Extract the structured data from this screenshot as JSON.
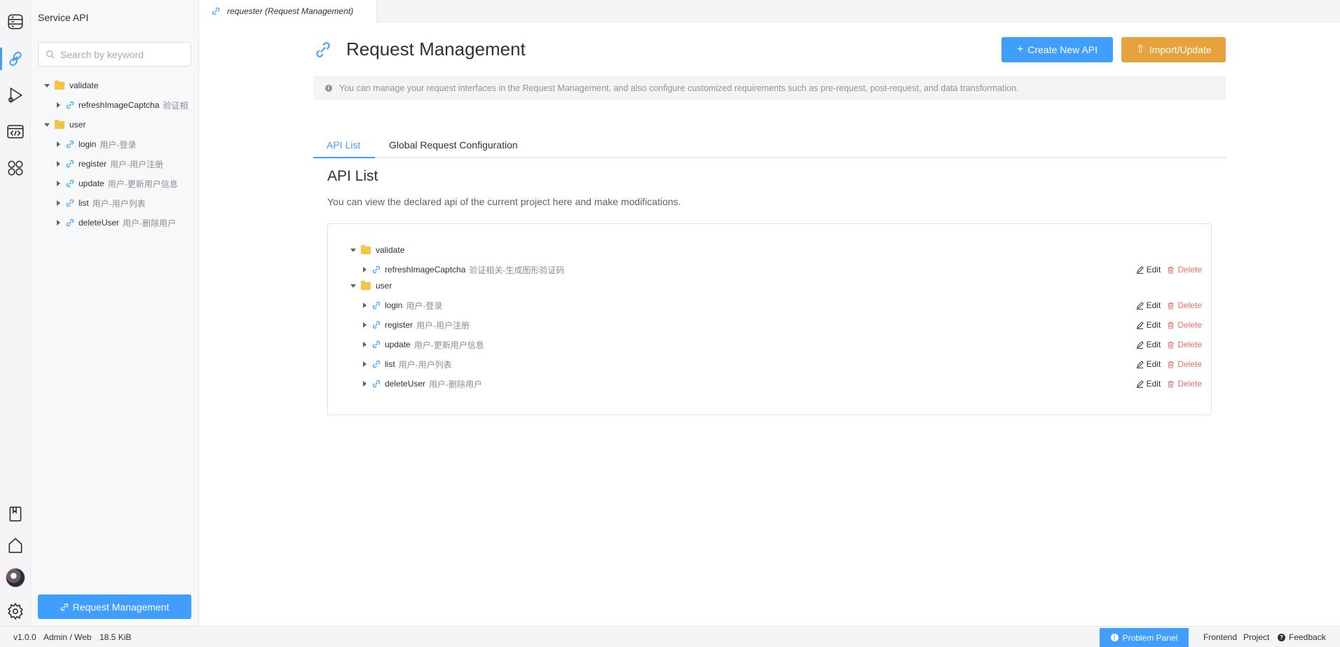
{
  "activity_bar": {
    "items": [
      {
        "icon": "database-icon"
      },
      {
        "icon": "link-icon",
        "active": true
      },
      {
        "icon": "debug-play-icon"
      },
      {
        "icon": "code-window-icon"
      },
      {
        "icon": "apps-icon"
      }
    ],
    "bottom": [
      {
        "icon": "bookmark-book-icon"
      },
      {
        "icon": "home-icon"
      },
      {
        "icon": "avatar"
      },
      {
        "icon": "gear-icon"
      }
    ]
  },
  "sidebar": {
    "title": "Service API",
    "search_placeholder": "Search by keyword",
    "tree": [
      {
        "type": "folder",
        "name": "validate",
        "expanded": true
      },
      {
        "type": "api",
        "name": "refreshImageCaptcha",
        "desc": "验证相"
      },
      {
        "type": "folder",
        "name": "user",
        "expanded": true
      },
      {
        "type": "api",
        "name": "login",
        "desc": "用户-登录"
      },
      {
        "type": "api",
        "name": "register",
        "desc": "用户-用户注册"
      },
      {
        "type": "api",
        "name": "update",
        "desc": "用户-更新用户信息"
      },
      {
        "type": "api",
        "name": "list",
        "desc": "用户-用户列表"
      },
      {
        "type": "api",
        "name": "deleteUser",
        "desc": "用户-删除用户"
      }
    ],
    "bottom_button": "Request Management"
  },
  "tabbar": {
    "active_tab": "requester (Request Management)"
  },
  "main": {
    "title": "Request Management",
    "create_button": "Create New API",
    "import_button": "Import/Update",
    "alert": "You can manage your request interfaces in the Request Management, and also configure customized requirements such as pre-request, post-request, and data transformation.",
    "tabs": [
      "API List",
      "Global Request Configuration"
    ],
    "section_title": "API List",
    "section_desc": "You can view the declared api of the current project here and make modifications.",
    "edit_label": "Edit",
    "delete_label": "Delete",
    "tree": [
      {
        "type": "folder",
        "name": "validate"
      },
      {
        "type": "api",
        "name": "refreshImageCaptcha",
        "desc": "验证相关-生成图形验证码"
      },
      {
        "type": "folder",
        "name": "user"
      },
      {
        "type": "api",
        "name": "login",
        "desc": "用户-登录"
      },
      {
        "type": "api",
        "name": "register",
        "desc": "用户-用户注册"
      },
      {
        "type": "api",
        "name": "update",
        "desc": "用户-更新用户信息"
      },
      {
        "type": "api",
        "name": "list",
        "desc": "用户-用户列表"
      },
      {
        "type": "api",
        "name": "deleteUser",
        "desc": "用户-删除用户"
      }
    ]
  },
  "status_bar": {
    "version": "v1.0.0",
    "mode": "Admin / Web",
    "size": "18.5 KiB",
    "problem_panel": "Problem Panel",
    "frontend": "Frontend",
    "project": "Project",
    "feedback": "Feedback"
  },
  "colors": {
    "primary": "#409eff",
    "warning": "#e6a23c",
    "danger": "#f56c6c",
    "folder": "#f6c344"
  }
}
